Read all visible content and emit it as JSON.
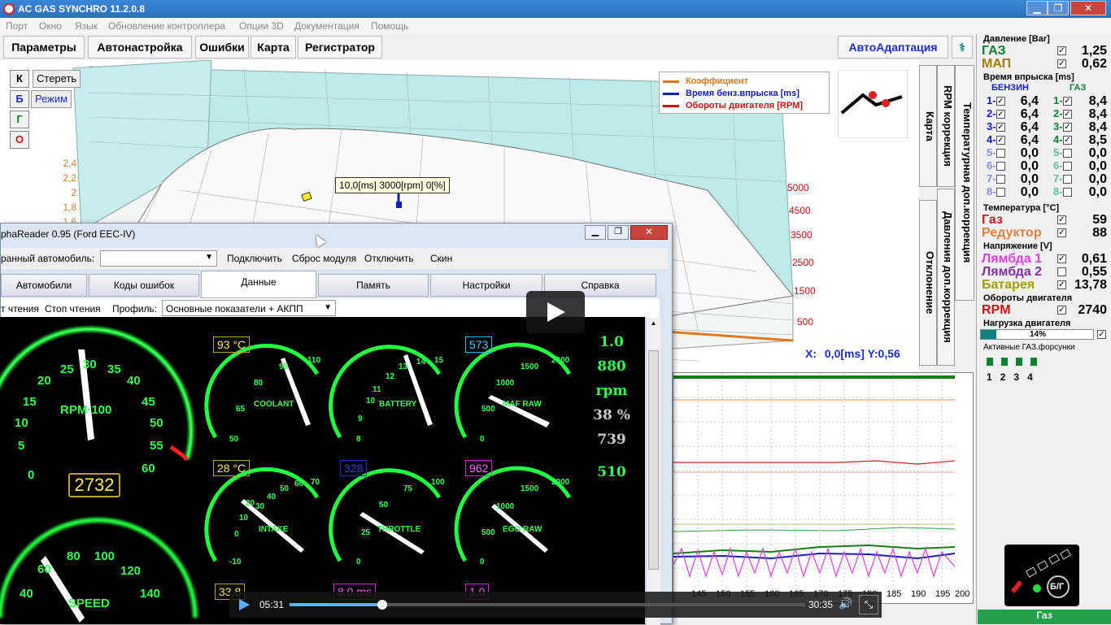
{
  "window": {
    "title": "AC GAS SYNCHRO  11.2.0.8",
    "min": "▁",
    "max": "❐",
    "close": "✕"
  },
  "menu": [
    "Порт",
    "Окно",
    "Язык",
    "Обновление контроллера",
    "Опции 3D",
    "Документация",
    "Помощь"
  ],
  "tabs": [
    "Параметры",
    "Автонастройка",
    "Ошибки",
    "Карта",
    "Регистратор"
  ],
  "autoadapt": "АвтоАдаптация",
  "leftbtns": {
    "k": "К",
    "b": "Б",
    "g": "Г",
    "o": "О",
    "erase": "Стереть",
    "mode": "Режим"
  },
  "yticks": [
    "2,4",
    "2,2",
    "2",
    "1,8",
    "1,6"
  ],
  "rpmticks": [
    "5000",
    "4500",
    "3500",
    "2500",
    "1500",
    "500"
  ],
  "legend": [
    {
      "label": "Коэффициент",
      "color": "#e07820"
    },
    {
      "label": "Время бенз.впрыска [ms]",
      "color": "#1020c0"
    },
    {
      "label": "Обороты двигателя [RPM]",
      "color": "#d01010"
    }
  ],
  "tooltip": "10,0[ms] 3000[rpm] 0[%]",
  "cursor": {
    "x_label": "X:",
    "x_val": "0,0[ms]",
    "y_label": "Y:",
    "y_val": "0,56"
  },
  "vtabs": [
    "RPM коррекция",
    "Карта",
    "Температурная доп.коррекция",
    "Давления доп.коррекция",
    "Отклонение"
  ],
  "right": {
    "pressure_h": "Давление [Bar]",
    "gas_label": "ГАЗ",
    "gas_val": "1,25",
    "map_label": "МАП",
    "map_val": "0,62",
    "inj_h": "Время впрыска [ms]",
    "benz_h": "БЕНЗИН",
    "gaz_h": "ГАЗ",
    "benz": [
      "6,4",
      "6,4",
      "6,4",
      "6,4",
      "0,0",
      "0,0",
      "0,0",
      "0,0"
    ],
    "gaz": [
      "8,4",
      "8,4",
      "8,4",
      "8,5",
      "0,0",
      "0,0",
      "0,0",
      "0,0"
    ],
    "temp_h": "Температура  [°C]",
    "t_gas_label": "Газ",
    "t_gas_val": "59",
    "t_red_label": "Редуктор",
    "t_red_val": "88",
    "volt_h": "Напряжение [V]",
    "l1_label": "Лямбда 1",
    "l1_val": "0,61",
    "l2_label": "Лямбда 2",
    "l2_val": "0,55",
    "bat_label": "Батарея",
    "bat_val": "13,78",
    "rpm_h": "Обороты двигателя",
    "rpm_label": "RPM",
    "rpm_val": "2740",
    "load_h": "Нагрузка двигателя",
    "load_val": "14%",
    "load_frac": 0.14,
    "inj_active_h": "Активные ГАЗ.форсунки",
    "inj_nums": [
      "1",
      "2",
      "3",
      "4"
    ],
    "switch_label": "Б/Г",
    "status": "Газ"
  },
  "alpha": {
    "title": "phaReader 0.95 (Ford EEC-IV)",
    "car_label": "ранный автомобиль:",
    "connect": "Подключить",
    "reset": "Сброс модуля",
    "disconnect": "Отключить",
    "skin": "Скин",
    "tabs": [
      "Автомобили",
      "Коды ошибок",
      "Данные",
      "Память",
      "Настройки",
      "Справка"
    ],
    "read": "т чтения",
    "stop": "Стоп чтения",
    "profile_label": "Профиль:",
    "profile": "Основные показатели + АКПП",
    "rpm_gauge": {
      "label": "RPM·100",
      "ticks": [
        "0",
        "5",
        "10",
        "15",
        "20",
        "25",
        "30",
        "35",
        "40",
        "45",
        "50",
        "55",
        "60"
      ],
      "value": "2732"
    },
    "speed_gauge": {
      "label": "SPEED",
      "ticks": [
        "40",
        "60",
        "80",
        "100",
        "120",
        "140"
      ]
    },
    "coolant": {
      "box": "93 °C",
      "label": "COOLANT",
      "ticks": [
        "50",
        "65",
        "80",
        "95",
        "110"
      ]
    },
    "battery": {
      "label": "BATTERY",
      "ticks": [
        "8",
        "9",
        "10",
        "11",
        "12",
        "13",
        "14",
        "15"
      ]
    },
    "maf": {
      "box": "573",
      "label": "MAF RAW",
      "ticks": [
        "0",
        "500",
        "1000",
        "1500",
        "2000"
      ]
    },
    "intake": {
      "box": "28 °C",
      "label": "INTAKE",
      "ticks": [
        "-10",
        "0",
        "10",
        "20",
        "30",
        "40",
        "50",
        "60",
        "70"
      ]
    },
    "throttle": {
      "box": "328",
      "label": "THROTTLE",
      "ticks": [
        "0",
        "25",
        "50",
        "75",
        "100"
      ]
    },
    "ego": {
      "box": "962",
      "label": "EGO RAW",
      "ticks": [
        "0",
        "500",
        "1000",
        "1500",
        "2000"
      ]
    },
    "readouts": [
      "1.0",
      "880 rpm",
      "38 %",
      "739",
      "510"
    ],
    "bottom_boxes": [
      "33.8",
      "8.0 ms",
      "1.0"
    ]
  },
  "video": {
    "current": "05:31",
    "total": "30:35",
    "progress": 0.18
  },
  "graph": {
    "xticks": [
      "145",
      "150",
      "155",
      "160",
      "165",
      "170",
      "175",
      "180",
      "185",
      "190",
      "195",
      "200"
    ]
  }
}
